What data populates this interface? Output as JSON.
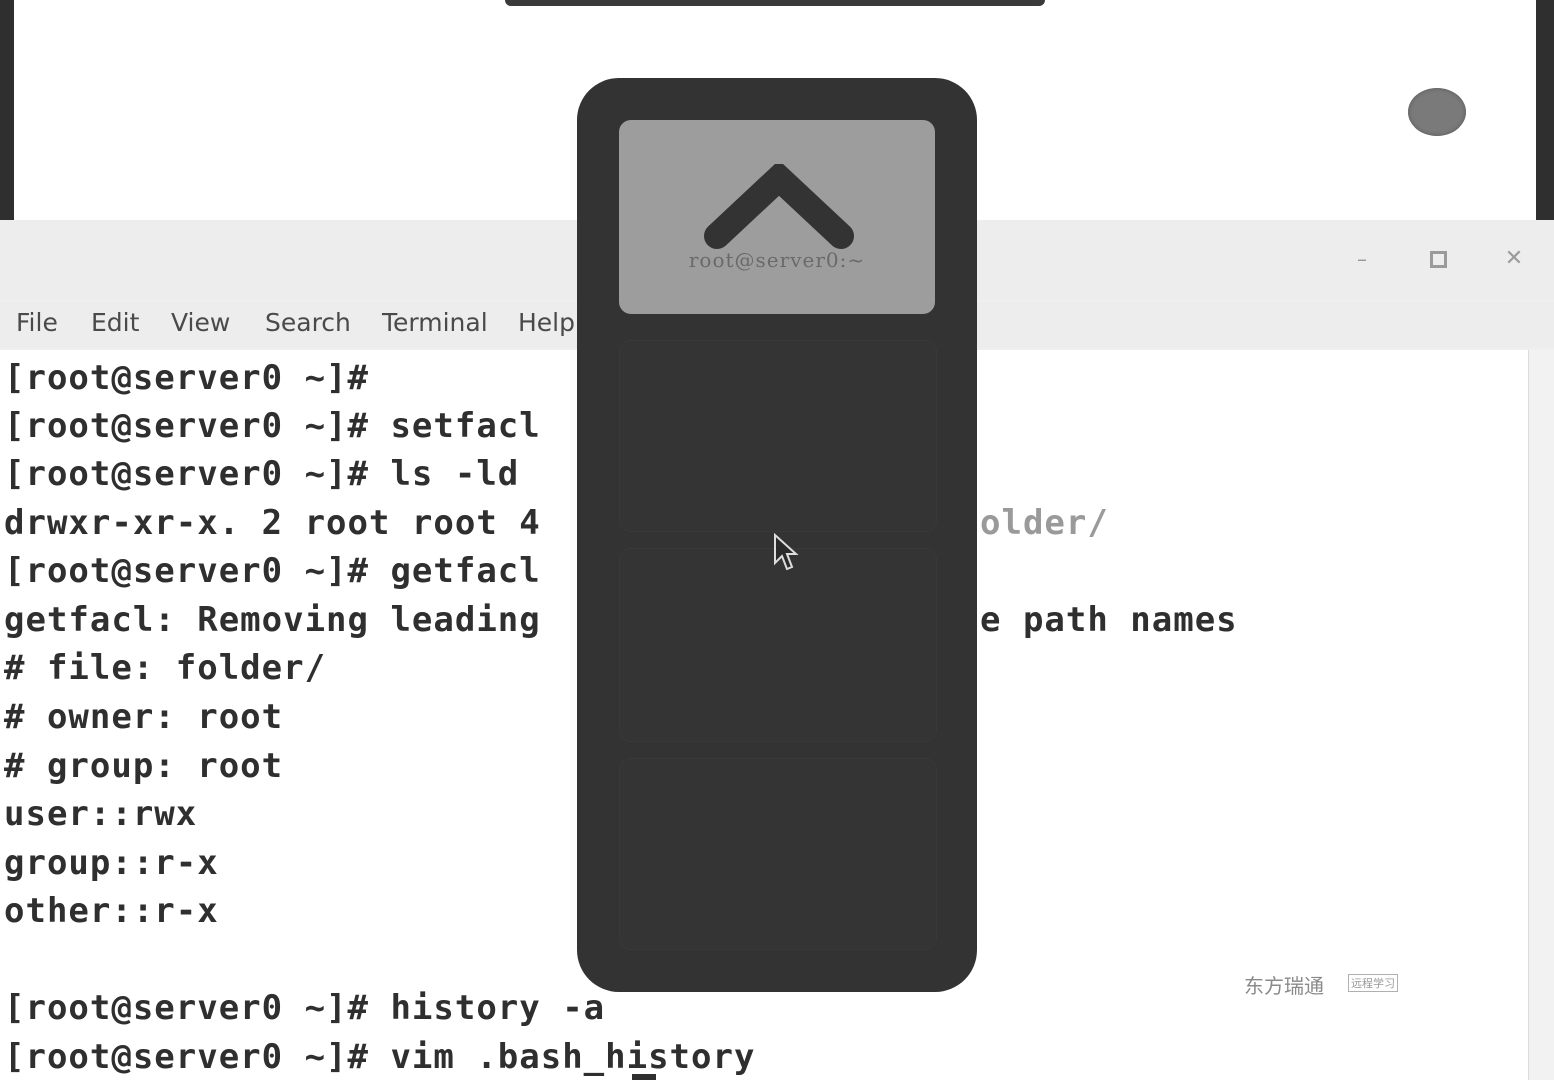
{
  "desktop": {
    "avatar_icon": "user-avatar-icon"
  },
  "window": {
    "controls": {
      "minimize": "minimize-icon",
      "maximize": "maximize-icon",
      "close": "close-icon"
    },
    "menu": [
      "File",
      "Edit",
      "View",
      "Search",
      "Terminal",
      "Help"
    ]
  },
  "terminal": {
    "lines": [
      "[root@server0 ~]#",
      "[root@server0 ~]# setfacl",
      "[root@server0 ~]# ls -ld",
      "drwxr-xr-x. 2 root root 4",
      "[root@server0 ~]# getfacl",
      "getfacl: Removing leading",
      "# file: folder/",
      "# owner: root",
      "# group: root",
      "user::rwx",
      "group::r-x",
      "other::r-x",
      "",
      "[root@server0 ~]# history -a",
      "[root@server0 ~]# vim .bash_history"
    ],
    "visible_fragments": [
      "older/",
      "e path names"
    ]
  },
  "workspace_switcher": {
    "active_label": "root@server0:~",
    "up_icon": "chevron-up-icon",
    "workspace_count": 4
  },
  "watermark": {
    "text": "东方瑞通",
    "tag": "远程学习"
  }
}
